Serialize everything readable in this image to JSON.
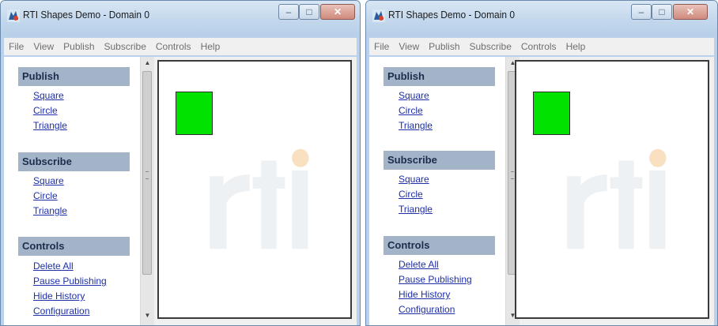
{
  "windows": [
    {
      "title": "RTI Shapes Demo - Domain 0",
      "menu": [
        "File",
        "View",
        "Publish",
        "Subscribe",
        "Controls",
        "Help"
      ],
      "sections": [
        {
          "header": "Publish",
          "links": [
            "Square",
            "Circle",
            "Triangle"
          ]
        },
        {
          "header": "Subscribe",
          "links": [
            "Square",
            "Circle",
            "Triangle"
          ]
        },
        {
          "header": "Controls",
          "links": [
            "Delete All",
            "Pause Publishing",
            "Hide History",
            "Configuration"
          ]
        }
      ],
      "shape": {
        "type": "square",
        "color": "#00e200"
      }
    },
    {
      "title": "RTI Shapes Demo - Domain 0",
      "menu": [
        "File",
        "View",
        "Publish",
        "Subscribe",
        "Controls",
        "Help"
      ],
      "sections": [
        {
          "header": "Publish",
          "links": [
            "Square",
            "Circle",
            "Triangle"
          ]
        },
        {
          "header": "Subscribe",
          "links": [
            "Square",
            "Circle",
            "Triangle"
          ]
        },
        {
          "header": "Controls",
          "links": [
            "Delete All",
            "Pause Publishing",
            "Hide History",
            "Configuration"
          ]
        }
      ],
      "shape": {
        "type": "square",
        "color": "#00e200"
      }
    }
  ],
  "icons": {
    "app": "rti-app-icon",
    "minimize": "minimize-icon",
    "maximize": "maximize-icon",
    "close": "close-icon",
    "scroll_up": "scroll-up-arrow-icon",
    "scroll_down": "scroll-down-arrow-icon"
  },
  "colors": {
    "square_fill": "#00e200",
    "section_header": "#a4b4c8",
    "link": "#1e2fa7",
    "watermark_dot": "#f6d3a7"
  }
}
